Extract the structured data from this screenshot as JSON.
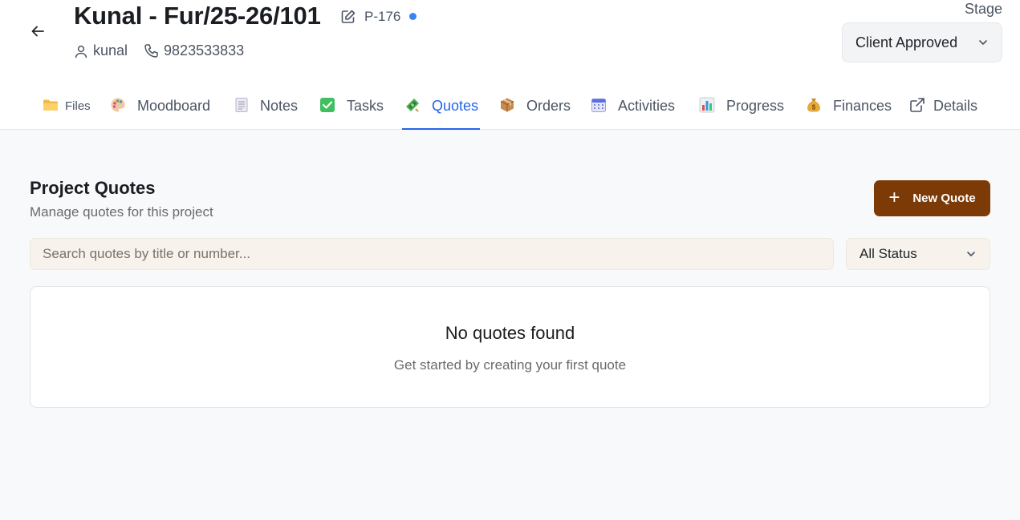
{
  "header": {
    "title": "Kunal - Fur/25-26/101",
    "project_code": "P-176",
    "client_name": "kunal",
    "phone": "9823533833",
    "stage_label": "Stage",
    "stage_value": "Client Approved"
  },
  "tabs": [
    {
      "label": "Files",
      "icon": "folder-icon",
      "active": false
    },
    {
      "label": "Moodboard",
      "icon": "palette-icon",
      "active": false
    },
    {
      "label": "Notes",
      "icon": "notepad-icon",
      "active": false
    },
    {
      "label": "Tasks",
      "icon": "check-box-icon",
      "active": false
    },
    {
      "label": "Quotes",
      "icon": "money-icon",
      "active": true
    },
    {
      "label": "Orders",
      "icon": "package-icon",
      "active": false
    },
    {
      "label": "Activities",
      "icon": "calendar-icon",
      "active": false
    },
    {
      "label": "Progress",
      "icon": "bar-chart-icon",
      "active": false
    },
    {
      "label": "Finances",
      "icon": "money-bag-icon",
      "active": false
    },
    {
      "label": "Details",
      "icon": "external-link-icon",
      "active": false
    }
  ],
  "quotes": {
    "title": "Project Quotes",
    "subtitle": "Manage quotes for this project",
    "new_button": "New Quote",
    "search_placeholder": "Search quotes by title or number...",
    "status_filter": "All Status",
    "empty_title": "No quotes found",
    "empty_subtitle": "Get started by creating your first quote"
  },
  "colors": {
    "accent": "#2563eb",
    "primary_button": "#7c3a06",
    "status_dot": "#3b82f6"
  }
}
